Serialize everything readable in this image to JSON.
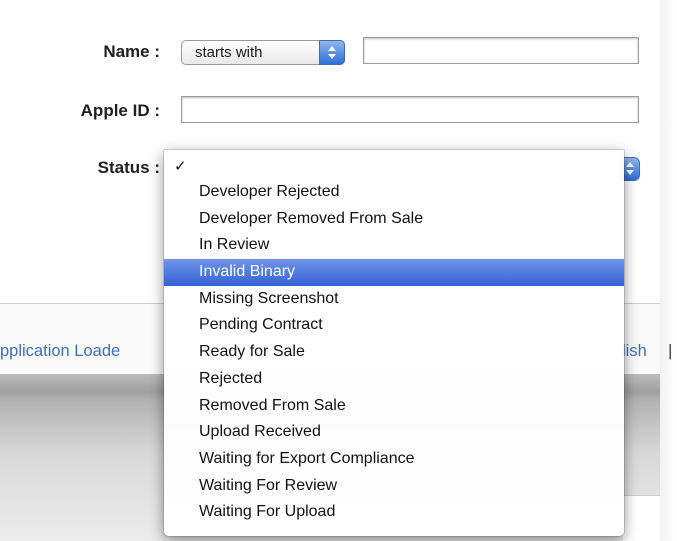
{
  "form": {
    "name_label": "Name :",
    "name_filter": "starts with",
    "name_value": "",
    "apple_id_label": "Apple ID :",
    "apple_id_value": "",
    "status_label": "Status :"
  },
  "status_menu": {
    "checkmark": "✓",
    "items": [
      "Developer Rejected",
      "Developer Removed From Sale",
      "In Review",
      "Invalid Binary",
      "Missing Screenshot",
      "Pending Contract",
      "Ready for Sale",
      "Rejected",
      "Removed From Sale",
      "Upload Received",
      "Waiting for Export Compliance",
      "Waiting For Review",
      "Waiting For Upload"
    ],
    "highlighted": "Invalid Binary"
  },
  "footer": {
    "link_left": "pplication Loade",
    "link_right": "lish",
    "separator": "|"
  },
  "colors": {
    "highlight": "#3b69d8",
    "link": "#3f6fb5"
  }
}
